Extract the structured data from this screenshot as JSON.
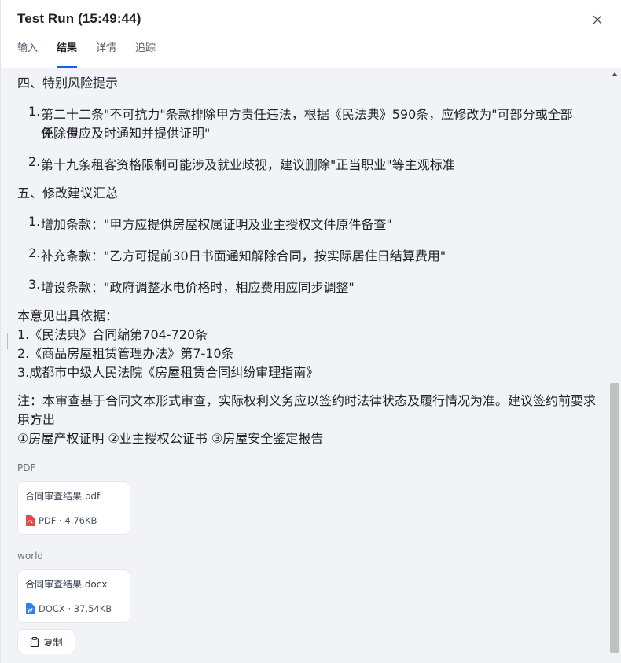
{
  "header": {
    "title": "Test Run (15:49:44)",
    "tabs": [
      "输入",
      "结果",
      "详情",
      "追踪"
    ],
    "active_tab": "结果"
  },
  "result": {
    "section4": {
      "title": "四、特别风险提示",
      "items": [
        {
          "num": "1.",
          "line1": "第二十二条\"不可抗力\"条款排除甲方责任违法，根据《民法典》590条，应修改为\"可部分或全部免除责",
          "line2": "任，但应及时通知并提供证明\""
        },
        {
          "num": "2.",
          "line1": "第十九条租客资格限制可能涉及就业歧视，建议删除\"正当职业\"等主观标准"
        }
      ]
    },
    "section5": {
      "title": "五、修改建议汇总",
      "items": [
        {
          "num": "1.",
          "text": "增加条款：\"甲方应提供房屋权属证明及业主授权文件原件备查\""
        },
        {
          "num": "2.",
          "text": "补充条款：\"乙方可提前30日书面通知解除合同，按实际居住日结算费用\""
        },
        {
          "num": "3.",
          "text": "增设条款：\"政府调整水电价格时，相应费用应同步调整\""
        }
      ]
    },
    "basis": {
      "title": "本意见出具依据：",
      "lines": [
        "1.《民法典》合同编第704-720条",
        "2.《商品房屋租赁管理办法》第7-10条",
        "3.成都市中级人民法院《房屋租赁合同纠纷审理指南》"
      ]
    },
    "note": {
      "line1": "注：本审查基于合同文本形式审查，实际权利义务应以签约时法律状态及履行情况为准。建议签约前要求甲方出",
      "line2": "示：",
      "line3": "①房屋产权证明 ②业主授权公证书 ③房屋安全鉴定报告"
    }
  },
  "files": [
    {
      "group_label": "PDF",
      "name": "合同审查结果.pdf",
      "meta": "PDF · 4.76KB",
      "icon": "pdf-file-icon",
      "color": "#e5484d"
    },
    {
      "group_label": "world",
      "name": "合同审查结果.docx",
      "meta": "DOCX · 37.54KB",
      "icon": "docx-file-icon",
      "color": "#2f7df6"
    }
  ],
  "actions": {
    "copy_label": "复制"
  },
  "colors": {
    "accent": "#155eef",
    "background": "#f2f3f7"
  }
}
